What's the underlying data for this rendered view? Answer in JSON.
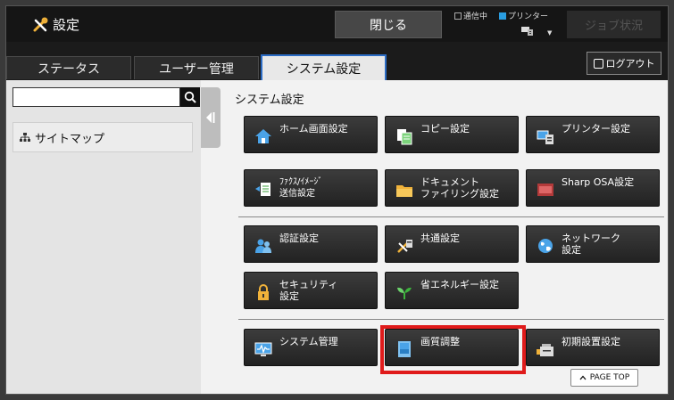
{
  "header": {
    "title": "設定",
    "close_label": "閉じる",
    "status_comm": "通信中",
    "status_printer": "プリンター",
    "job_status_label": "ジョブ状況",
    "colors": {
      "accent": "#2a9de0"
    }
  },
  "tabs": [
    {
      "label": "ステータス",
      "active": false
    },
    {
      "label": "ユーザー管理",
      "active": false
    },
    {
      "label": "システム設定",
      "active": true
    }
  ],
  "logout_label": "ログアウト",
  "sidebar": {
    "search_placeholder": "",
    "sitemap_label": "サイトマップ"
  },
  "main": {
    "section_title": "システム設定",
    "tiles": [
      {
        "label": "ホーム画面設定",
        "icon": "home-icon"
      },
      {
        "label": "コピー設定",
        "icon": "copy-icon"
      },
      {
        "label": "プリンター設定",
        "icon": "printer-icon"
      },
      {
        "label": "ﾌｧｸｽ/ｲﾒｰｼﾞ\n送信設定",
        "icon": "fax-send-icon"
      },
      {
        "label": "ドキュメント\nファイリング設定",
        "icon": "folder-icon"
      },
      {
        "label": "Sharp OSA設定",
        "icon": "osa-icon"
      },
      {
        "label": "認証設定",
        "icon": "users-icon"
      },
      {
        "label": "共通設定",
        "icon": "common-settings-icon"
      },
      {
        "label": "ネットワーク\n設定",
        "icon": "globe-icon"
      },
      {
        "label": "セキュリティ\n設定",
        "icon": "lock-icon"
      },
      {
        "label": "省エネルギー設定",
        "icon": "leaf-icon"
      },
      {
        "label": "システム管理",
        "icon": "monitor-icon"
      },
      {
        "label": "画質調整",
        "icon": "image-quality-icon",
        "highlighted": true
      },
      {
        "label": "初期設置設定",
        "icon": "machine-setup-icon"
      }
    ],
    "page_top_label": "PAGE TOP"
  }
}
